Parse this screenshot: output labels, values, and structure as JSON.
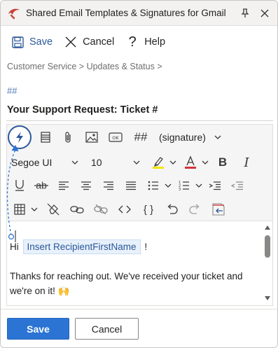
{
  "window": {
    "title": "Shared Email Templates & Signatures for Gmail",
    "brand_color": "#c8423b"
  },
  "commands": {
    "save": "Save",
    "cancel": "Cancel",
    "help": "Help",
    "accent": "#2b579a"
  },
  "breadcrumb": "Customer Service > Updates & Status >",
  "shortcut": "##",
  "subject": "Your Support Request: Ticket #",
  "toolbar": {
    "macro_label": "##",
    "signature_label": "(signature)",
    "font_name": "Segoe UI",
    "font_size": "10",
    "bold_label": "B",
    "italic_label": "I",
    "highlight_color": "#f2e600",
    "font_color": "#d13438",
    "icons": [
      "insert-macro-icon",
      "paragraph-icon",
      "attach-icon",
      "image-icon",
      "ok-button-icon",
      "hash-icon",
      "chevron-down-icon",
      "highlight-icon",
      "font-color-icon",
      "underline-icon",
      "strikethrough-icon",
      "align-left-icon",
      "align-center-icon",
      "align-right-icon",
      "justify-icon",
      "bullet-list-icon",
      "numbered-list-icon",
      "indent-icon",
      "outdent-icon",
      "table-icon",
      "clear-format-icon",
      "link-icon",
      "unlink-icon",
      "code-view-icon",
      "braces-icon",
      "undo-icon",
      "redo-icon",
      "insert-html-icon"
    ]
  },
  "body": {
    "greeting": "Hi",
    "placeholder": "Insert RecipientFirstName",
    "excl": "!",
    "paragraph": "Thanks for reaching out. We've received your ticket and we're on it! 🙌"
  },
  "footer": {
    "save": "Save",
    "cancel": "Cancel"
  }
}
